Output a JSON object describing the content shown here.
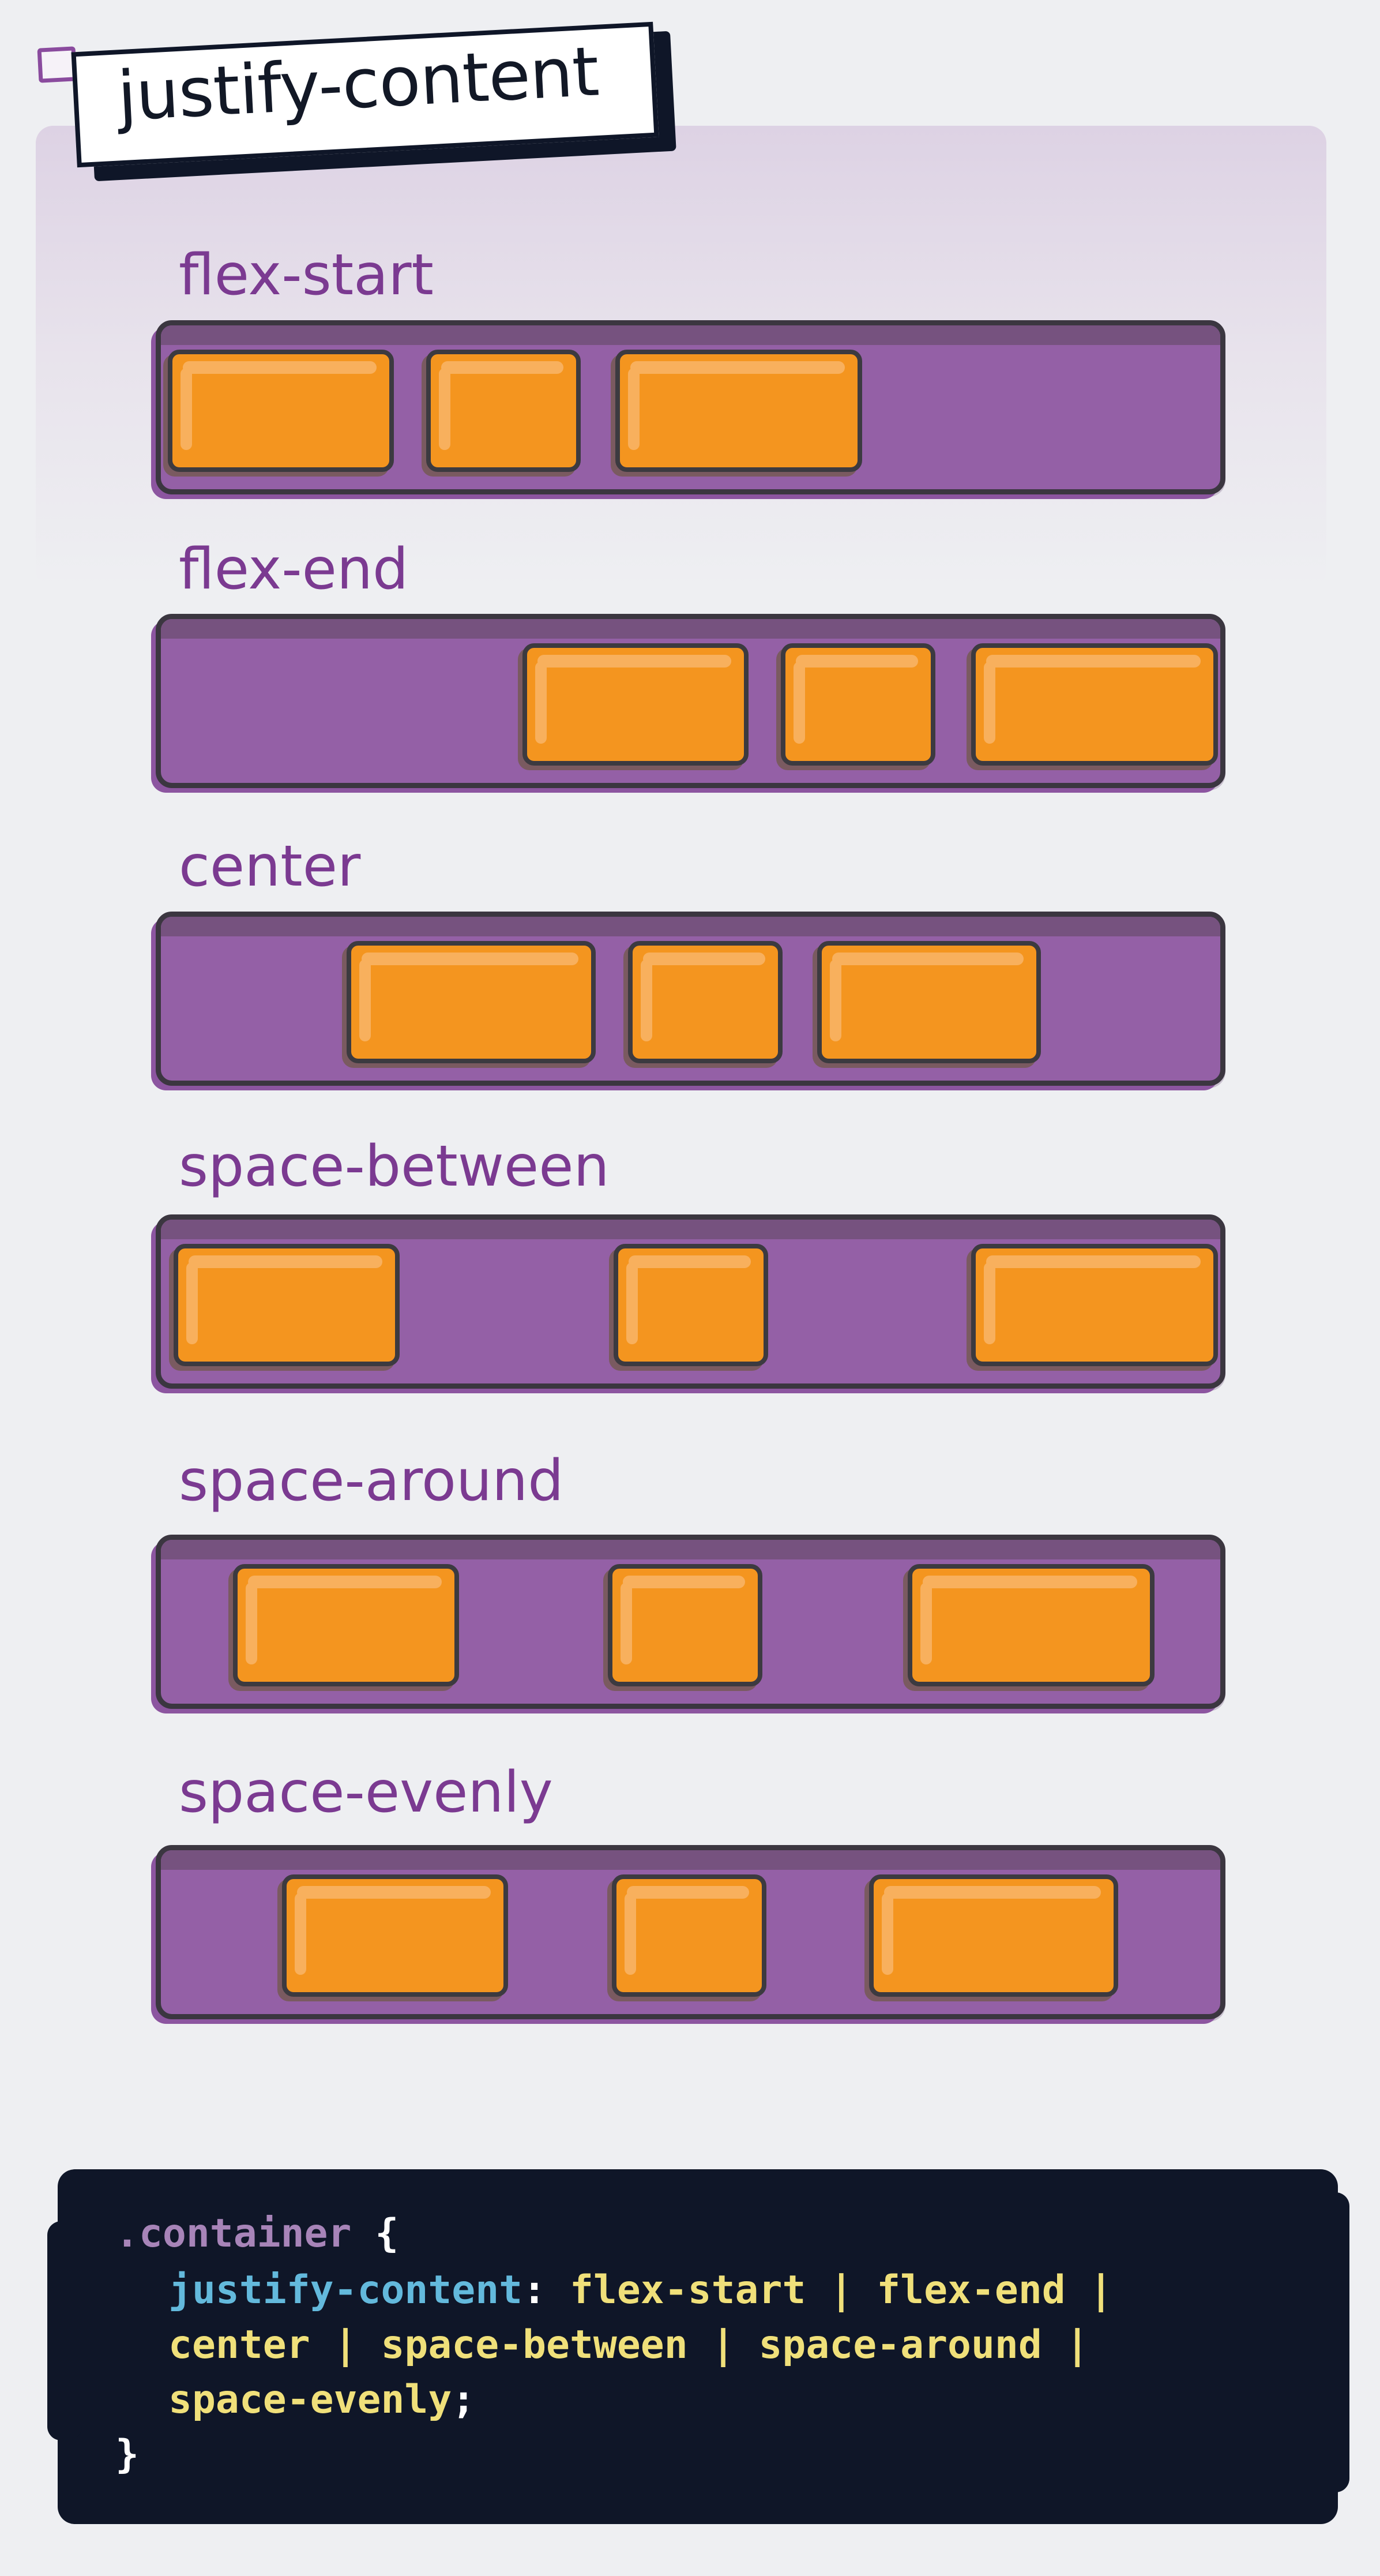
{
  "title": "justify-content",
  "colors": {
    "background": "#eeeff2",
    "track": "#9460a6",
    "box": "#f4951f",
    "label": "#7b3a91",
    "code_bg": "#0f1628",
    "code_property": "#63b9dc",
    "code_value": "#f0e07a"
  },
  "sections": [
    {
      "label": "flex-start"
    },
    {
      "label": "flex-end"
    },
    {
      "label": "center"
    },
    {
      "label": "space-between"
    },
    {
      "label": "space-around"
    },
    {
      "label": "space-evenly"
    }
  ],
  "code": {
    "selector": ".container",
    "open_brace": " {",
    "property": "justify-content",
    "colon": ": ",
    "values_line1": "flex-start | flex-end |",
    "values_line2": "center | space-between | space-around |",
    "values_line3": "space-evenly",
    "semicolon": ";",
    "close_brace": "}"
  }
}
